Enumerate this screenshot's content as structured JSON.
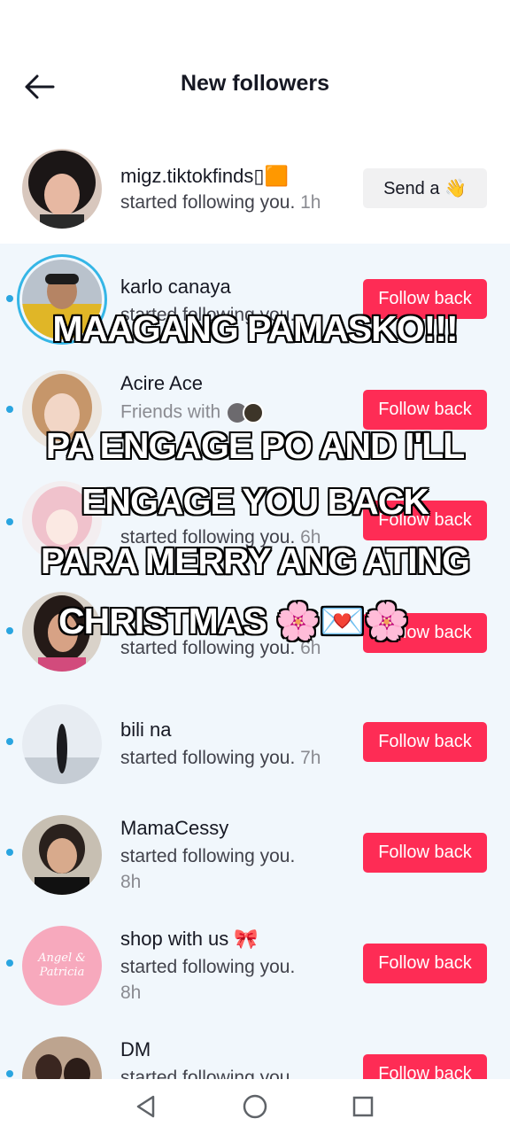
{
  "header": {
    "title": "New followers"
  },
  "followers": [
    {
      "name": "migz.tiktokfinds▯🟧",
      "status": "started following you.",
      "time": "1h",
      "action": "Send a 👋"
    },
    {
      "name": "karlo canaya",
      "status": "started following you.",
      "time": "",
      "action": "Follow back"
    },
    {
      "name": "Acire Ace",
      "status": "Friends with",
      "time": "",
      "action": "Follow back"
    },
    {
      "name": "",
      "status": "started following you.",
      "time": "6h",
      "action": "Follow back"
    },
    {
      "name": "",
      "status": "started following you.",
      "time": "6h",
      "action": "Follow back"
    },
    {
      "name": "bili na",
      "status": "started following you.",
      "time": "7h",
      "action": "Follow back"
    },
    {
      "name": "MamaCessy",
      "status": "started following you.",
      "time": "8h",
      "action": "Follow back"
    },
    {
      "name": "shop with us 🎀",
      "status": "started following you.",
      "time": "8h",
      "action": "Follow back",
      "avatar_text": "Angel & Patricia"
    },
    {
      "name": "DM",
      "status": "started following you.",
      "time": "",
      "action": "Follow back"
    }
  ],
  "overlay": {
    "line1": "MAAGANG PAMASKO!!!",
    "line2": "PA ENGAGE PO AND I'LL",
    "line3": "ENGAGE YOU BACK",
    "line4": "PARA MERRY ANG ATING",
    "line5": "CHRISTMAS 🌸💌🌸"
  },
  "colors": {
    "accent": "#fe2c55",
    "unread_dot": "#2aa5e0",
    "unread_bg": "#f1f7fc"
  },
  "icons": {
    "back": "arrow-left-icon",
    "nav_back": "triangle-back-icon",
    "nav_home": "circle-home-icon",
    "nav_recent": "square-recent-icon"
  }
}
